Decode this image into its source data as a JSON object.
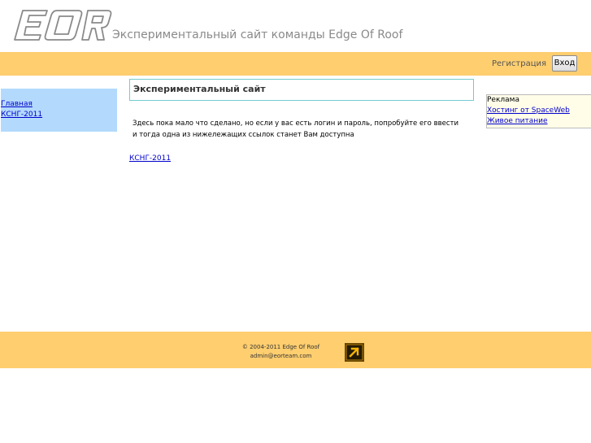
{
  "header": {
    "site_title": "Экспериментальный сайт команды Edge Of Roof"
  },
  "topbar": {
    "register_label": "Регистрация",
    "login_label": "Вход"
  },
  "sidebar": {
    "items": [
      {
        "label": "Главная"
      },
      {
        "label": "КСНГ-2011"
      }
    ]
  },
  "content": {
    "title": "Экспериментальный сайт",
    "text": "Здесь пока мало что сделано, но если у вас есть логин и пароль, попробуйте его ввести и тогда одна из нижележащих ссылок станет Вам доступна",
    "link_label": "КСНГ-2011"
  },
  "ads": {
    "title": "Реклама",
    "items": [
      {
        "label": "Хостинг от SpaceWeb"
      },
      {
        "label": "Живое питание"
      }
    ]
  },
  "footer": {
    "copyright": "© 2004-2011 Edge Of Roof",
    "email": "admin@eorteam.com"
  },
  "colors": {
    "bar": "#fece6f",
    "sidebar": "#b3dafd",
    "title_border": "#74cbd0",
    "link": "#0000cc"
  },
  "icons": {
    "logo": "eor-logo-icon",
    "footer_badge": "arrow-up-right-icon"
  }
}
